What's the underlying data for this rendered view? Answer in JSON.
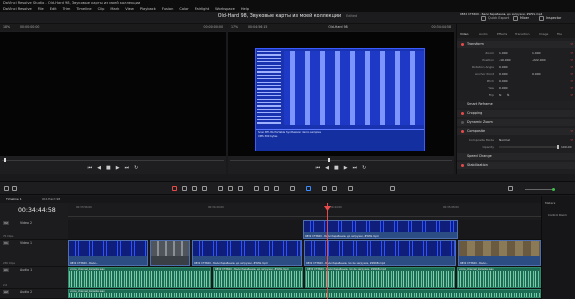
{
  "window": {
    "title": "DaVinci Resolve Studio - Old-Hard 98, Звуковые карты из моей коллекции"
  },
  "menu": [
    "DaVinci Resolve",
    "File",
    "Edit",
    "Trim",
    "Timeline",
    "Clip",
    "Mark",
    "View",
    "Playback",
    "Fusion",
    "Color",
    "Fairlight",
    "Workspace",
    "Help"
  ],
  "project": {
    "title": "Old-Hard 98, Звуковые карты из моей коллекции",
    "status": "Edited"
  },
  "top_buttons": {
    "render": "Quick Export",
    "mixer": "Mixer",
    "inspector": "Inspector"
  },
  "source_viewer": {
    "zoom": "18%",
    "timecode_in": "00:00:00:00",
    "timecode_out": "00:00:00:00"
  },
  "timeline_viewer": {
    "zoom": "17%",
    "duration": "00:04:56:15",
    "name": "Old-Hard 98",
    "timecode": "00:34:44:58"
  },
  "dos_screen": {
    "status_line_1": "Scan BTI-8A Portable Synthesizer demo samples",
    "status_line_2": "XMS 300 bytes"
  },
  "inspector": {
    "clip_name": "0832 CT3600 - Бали барабанов, до загрузки, #WSS.mp4",
    "tabs": [
      "Video",
      "Audio",
      "Effects",
      "Transition",
      "Image",
      "File"
    ],
    "sections": [
      {
        "name": "Transform",
        "rows": [
          {
            "key": "Zoom",
            "v1": "1.000",
            "v2": "1.000"
          },
          {
            "key": "Position",
            "v1": "-10.000",
            "v2": "-222.000"
          },
          {
            "key": "Rotation Angle",
            "v1": "0.000"
          },
          {
            "key": "Anchor Point",
            "v1": "0.000",
            "v2": "0.000"
          },
          {
            "key": "Pitch",
            "v1": "0.000"
          },
          {
            "key": "Yaw",
            "v1": "0.000"
          },
          {
            "key": "Flip",
            "v1": ""
          }
        ]
      },
      {
        "name": "Smart Reframe"
      },
      {
        "name": "Cropping"
      },
      {
        "name": "Dynamic Zoom"
      },
      {
        "name": "Composite",
        "rows": [
          {
            "key": "Composite Mode",
            "v1": "Normal"
          },
          {
            "key": "Opacity",
            "v1": "100.00"
          }
        ]
      },
      {
        "name": "Speed Change"
      },
      {
        "name": "Stabilization"
      }
    ]
  },
  "timeline": {
    "tabs": [
      "Timeline 1",
      "Old-Hard 98"
    ],
    "timecode": "00:34:44:58",
    "ruler": [
      "00:33:56:00",
      "00:34:20:00",
      "00:34:44:00",
      "00:35:08:00",
      "00:35:32:00"
    ],
    "tracks": [
      {
        "badge": "V2",
        "name": "Video 2",
        "clips_count": "70 Clips"
      },
      {
        "badge": "V1",
        "name": "Video 1",
        "clips_count": "236 Clips"
      },
      {
        "badge": "A1",
        "name": "Audio 1",
        "clips_count": "2.0",
        "volume": "0.0"
      },
      {
        "badge": "A2",
        "name": "Audio 2",
        "clips_count": "2.0"
      }
    ],
    "clips": {
      "v2_1": "0832 CT3600 - Бали барабанов, до загрузки, #WSS.mp4",
      "v1_1": "0832 CT3600 - Бали...",
      "v1_2": "0832 CT3600 - Бали барабанов, до загрузки, #WSS.mp4",
      "v1_3": "0832 CT3600 - Бали барабанов, после загрузки, #ZKKB.mp4",
      "v1_4": "0832 CT3600 - Бали...",
      "a1_1": "voice_channel_karaoke.wav",
      "a1_2": "0832 CT3600 - Бали барабанов, до загрузки, #WSS.mp4",
      "a1_3": "0832 CT3600 - Бали барабанов, после загрузки, #ZKKB.mp4",
      "a1_4": "voice_channel_karaoke.wav",
      "a2_1": "voice_channel_karaoke.wav"
    }
  },
  "meters": {
    "title": "Meters",
    "label": "Control Room"
  }
}
